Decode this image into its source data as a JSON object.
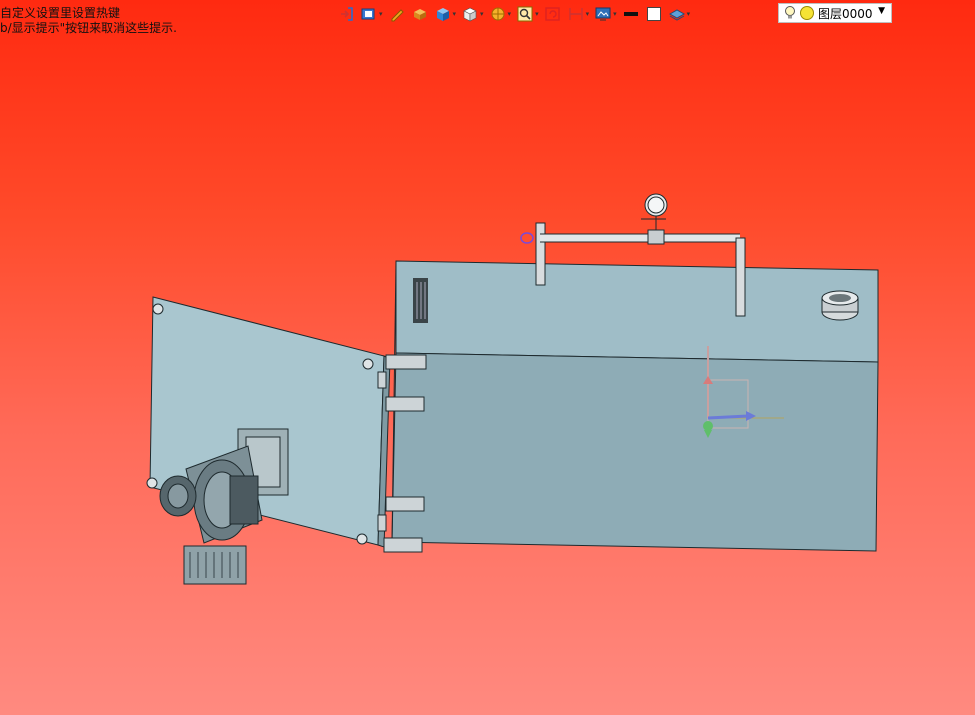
{
  "hint": {
    "line1": "自定义设置里设置热键",
    "line2": "b/显示提示\"按钮来取消这些提示."
  },
  "toolbar": {
    "buttons": [
      {
        "icon": "insert-icon",
        "dropdown": false
      },
      {
        "icon": "view-orientation-icon",
        "dropdown": true
      },
      {
        "icon": "pencil-icon",
        "dropdown": false
      },
      {
        "icon": "shaded-box-icon",
        "dropdown": false
      },
      {
        "icon": "blue-cube-icon",
        "dropdown": true
      },
      {
        "icon": "white-cube-icon",
        "dropdown": true
      },
      {
        "icon": "render-style-icon",
        "dropdown": true
      },
      {
        "icon": "zoom-icon",
        "dropdown": true
      },
      {
        "icon": "rotate-view-icon",
        "dropdown": false
      },
      {
        "icon": "measure-icon",
        "dropdown": true
      },
      {
        "icon": "display-icon",
        "dropdown": true
      },
      {
        "icon": "line-color-icon",
        "dropdown": false
      },
      {
        "icon": "fill-color-icon",
        "dropdown": false
      },
      {
        "icon": "layer-stack-icon",
        "dropdown": true
      }
    ]
  },
  "layer": {
    "name": "图层0000",
    "bulb_icon": "lightbulb-icon",
    "color": "#f5e335"
  },
  "colors": {
    "part": "#a8c3cc",
    "part_dark": "#8fabb5",
    "edge": "#1e2a2e",
    "axis_x": "#6b7bd8",
    "axis_y": "#d87b7b",
    "axis_z": "#5fbf6a"
  }
}
